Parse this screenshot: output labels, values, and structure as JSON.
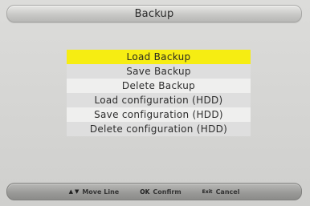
{
  "title": "Backup",
  "menu": {
    "items": [
      {
        "label": "Load Backup"
      },
      {
        "label": "Save Backup"
      },
      {
        "label": "Delete Backup"
      },
      {
        "label": "Load configuration (HDD)"
      },
      {
        "label": "Save configuration (HDD)"
      },
      {
        "label": "Delete configuration (HDD)"
      }
    ],
    "selected_index": 0
  },
  "footer": {
    "move": {
      "up_icon": "▲",
      "down_icon": "▼",
      "label": "Move Line"
    },
    "confirm": {
      "key": "OK",
      "label": "Confirm"
    },
    "cancel": {
      "key": "Exit",
      "label": "Cancel"
    }
  },
  "colors": {
    "selected_bg": "#f6ed12",
    "row_light": "#efefee",
    "row_dark": "#dedede",
    "background": "#d4d4d2"
  }
}
